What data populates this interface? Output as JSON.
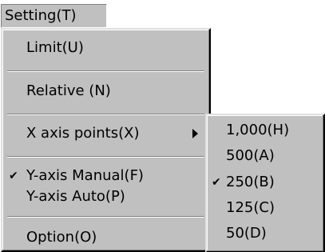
{
  "menubar": {
    "label": "Setting(T)"
  },
  "menu": {
    "items": [
      {
        "label": "Limit(U)",
        "checked": false,
        "submenu": false
      },
      {
        "label": "Relative (N)",
        "checked": false,
        "submenu": false
      },
      {
        "label": "X axis points(X)",
        "checked": false,
        "submenu": true,
        "arrow_icon": "submenu-arrow-icon"
      },
      {
        "label": "Y-axis Manual(F)",
        "checked": true,
        "check_icon": "checkmark-icon",
        "check_glyph": "✔"
      },
      {
        "label": "Y-axis Auto(P)",
        "checked": false
      },
      {
        "label": "Option(O)",
        "checked": false
      }
    ]
  },
  "submenu": {
    "items": [
      {
        "label": "1,000(H)",
        "checked": false
      },
      {
        "label": "500(A)",
        "checked": false
      },
      {
        "label": "250(B)",
        "checked": true,
        "check_icon": "checkmark-icon",
        "check_glyph": "✔"
      },
      {
        "label": "125(C)",
        "checked": false
      },
      {
        "label": "50(D)",
        "checked": false
      }
    ]
  },
  "colors": {
    "menu_background": "#c0c0c0",
    "text": "#000000"
  }
}
